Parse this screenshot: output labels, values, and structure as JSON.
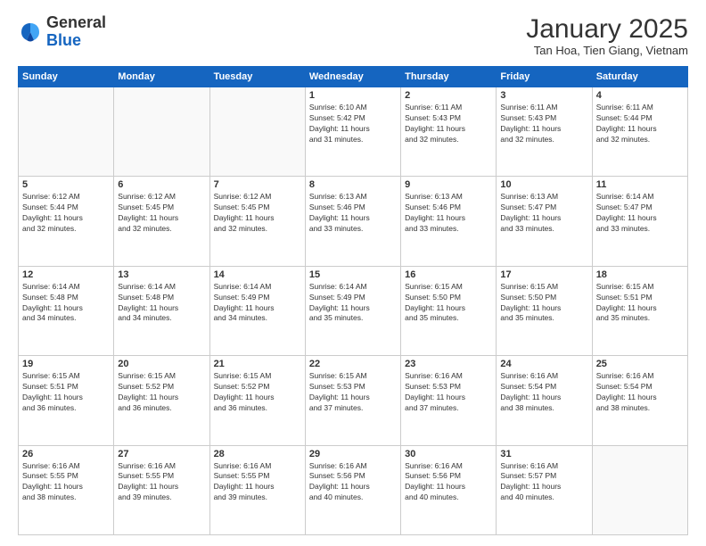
{
  "logo": {
    "general": "General",
    "blue": "Blue"
  },
  "header": {
    "month": "January 2025",
    "location": "Tan Hoa, Tien Giang, Vietnam"
  },
  "days_of_week": [
    "Sunday",
    "Monday",
    "Tuesday",
    "Wednesday",
    "Thursday",
    "Friday",
    "Saturday"
  ],
  "weeks": [
    [
      {
        "day": "",
        "info": ""
      },
      {
        "day": "",
        "info": ""
      },
      {
        "day": "",
        "info": ""
      },
      {
        "day": "1",
        "info": "Sunrise: 6:10 AM\nSunset: 5:42 PM\nDaylight: 11 hours\nand 31 minutes."
      },
      {
        "day": "2",
        "info": "Sunrise: 6:11 AM\nSunset: 5:43 PM\nDaylight: 11 hours\nand 32 minutes."
      },
      {
        "day": "3",
        "info": "Sunrise: 6:11 AM\nSunset: 5:43 PM\nDaylight: 11 hours\nand 32 minutes."
      },
      {
        "day": "4",
        "info": "Sunrise: 6:11 AM\nSunset: 5:44 PM\nDaylight: 11 hours\nand 32 minutes."
      }
    ],
    [
      {
        "day": "5",
        "info": "Sunrise: 6:12 AM\nSunset: 5:44 PM\nDaylight: 11 hours\nand 32 minutes."
      },
      {
        "day": "6",
        "info": "Sunrise: 6:12 AM\nSunset: 5:45 PM\nDaylight: 11 hours\nand 32 minutes."
      },
      {
        "day": "7",
        "info": "Sunrise: 6:12 AM\nSunset: 5:45 PM\nDaylight: 11 hours\nand 32 minutes."
      },
      {
        "day": "8",
        "info": "Sunrise: 6:13 AM\nSunset: 5:46 PM\nDaylight: 11 hours\nand 33 minutes."
      },
      {
        "day": "9",
        "info": "Sunrise: 6:13 AM\nSunset: 5:46 PM\nDaylight: 11 hours\nand 33 minutes."
      },
      {
        "day": "10",
        "info": "Sunrise: 6:13 AM\nSunset: 5:47 PM\nDaylight: 11 hours\nand 33 minutes."
      },
      {
        "day": "11",
        "info": "Sunrise: 6:14 AM\nSunset: 5:47 PM\nDaylight: 11 hours\nand 33 minutes."
      }
    ],
    [
      {
        "day": "12",
        "info": "Sunrise: 6:14 AM\nSunset: 5:48 PM\nDaylight: 11 hours\nand 34 minutes."
      },
      {
        "day": "13",
        "info": "Sunrise: 6:14 AM\nSunset: 5:48 PM\nDaylight: 11 hours\nand 34 minutes."
      },
      {
        "day": "14",
        "info": "Sunrise: 6:14 AM\nSunset: 5:49 PM\nDaylight: 11 hours\nand 34 minutes."
      },
      {
        "day": "15",
        "info": "Sunrise: 6:14 AM\nSunset: 5:49 PM\nDaylight: 11 hours\nand 35 minutes."
      },
      {
        "day": "16",
        "info": "Sunrise: 6:15 AM\nSunset: 5:50 PM\nDaylight: 11 hours\nand 35 minutes."
      },
      {
        "day": "17",
        "info": "Sunrise: 6:15 AM\nSunset: 5:50 PM\nDaylight: 11 hours\nand 35 minutes."
      },
      {
        "day": "18",
        "info": "Sunrise: 6:15 AM\nSunset: 5:51 PM\nDaylight: 11 hours\nand 35 minutes."
      }
    ],
    [
      {
        "day": "19",
        "info": "Sunrise: 6:15 AM\nSunset: 5:51 PM\nDaylight: 11 hours\nand 36 minutes."
      },
      {
        "day": "20",
        "info": "Sunrise: 6:15 AM\nSunset: 5:52 PM\nDaylight: 11 hours\nand 36 minutes."
      },
      {
        "day": "21",
        "info": "Sunrise: 6:15 AM\nSunset: 5:52 PM\nDaylight: 11 hours\nand 36 minutes."
      },
      {
        "day": "22",
        "info": "Sunrise: 6:15 AM\nSunset: 5:53 PM\nDaylight: 11 hours\nand 37 minutes."
      },
      {
        "day": "23",
        "info": "Sunrise: 6:16 AM\nSunset: 5:53 PM\nDaylight: 11 hours\nand 37 minutes."
      },
      {
        "day": "24",
        "info": "Sunrise: 6:16 AM\nSunset: 5:54 PM\nDaylight: 11 hours\nand 38 minutes."
      },
      {
        "day": "25",
        "info": "Sunrise: 6:16 AM\nSunset: 5:54 PM\nDaylight: 11 hours\nand 38 minutes."
      }
    ],
    [
      {
        "day": "26",
        "info": "Sunrise: 6:16 AM\nSunset: 5:55 PM\nDaylight: 11 hours\nand 38 minutes."
      },
      {
        "day": "27",
        "info": "Sunrise: 6:16 AM\nSunset: 5:55 PM\nDaylight: 11 hours\nand 39 minutes."
      },
      {
        "day": "28",
        "info": "Sunrise: 6:16 AM\nSunset: 5:55 PM\nDaylight: 11 hours\nand 39 minutes."
      },
      {
        "day": "29",
        "info": "Sunrise: 6:16 AM\nSunset: 5:56 PM\nDaylight: 11 hours\nand 40 minutes."
      },
      {
        "day": "30",
        "info": "Sunrise: 6:16 AM\nSunset: 5:56 PM\nDaylight: 11 hours\nand 40 minutes."
      },
      {
        "day": "31",
        "info": "Sunrise: 6:16 AM\nSunset: 5:57 PM\nDaylight: 11 hours\nand 40 minutes."
      },
      {
        "day": "",
        "info": ""
      }
    ]
  ]
}
